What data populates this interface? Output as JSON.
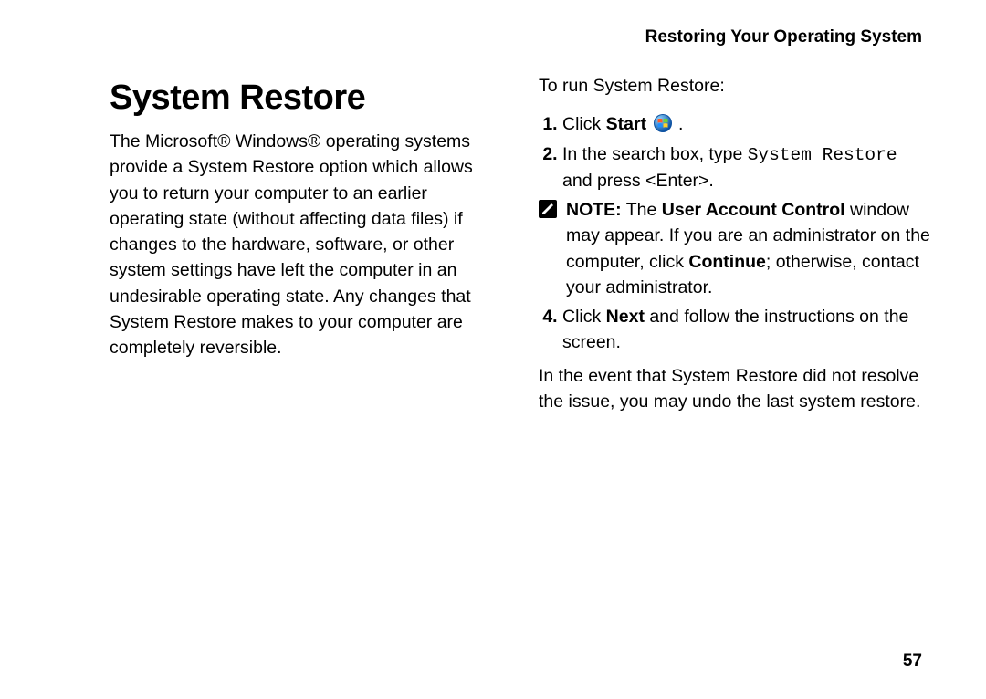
{
  "header": {
    "running_title": "Restoring Your Operating System"
  },
  "left": {
    "title": "System Restore",
    "para1": "The Microsoft® Windows® operating systems provide a System Restore option which allows you to return your computer to an earlier operating state (without affecting data files) if changes to the hardware, software, or other system settings have left the computer in an undesirable operating state. Any changes that System Restore makes to your computer are completely reversible."
  },
  "right": {
    "intro": "To run System Restore:",
    "steps": {
      "s1_prefix": "Click ",
      "s1_bold": "Start",
      "s1_suffix": " .",
      "s2_prefix": "In the search box, type ",
      "s2_code": "System Restore",
      "s2_suffix": " and press <Enter>.",
      "s3_prefix": "Click ",
      "s3_bold": "Next",
      "s3_suffix": " and follow the instructions on the screen."
    },
    "note": {
      "label": "NOTE:",
      "t1": " The ",
      "b1": "User Account Control",
      "t2": " window may appear. If you are an administrator on the computer, click ",
      "b2": "Continue",
      "t3": "; otherwise, contact your administrator."
    },
    "closing": "In the event that System Restore did not resolve the issue, you may undo the last system restore."
  },
  "page_number": "57",
  "icons": {
    "start_orb": "windows-start-orb-icon",
    "note": "note-pencil-icon"
  }
}
